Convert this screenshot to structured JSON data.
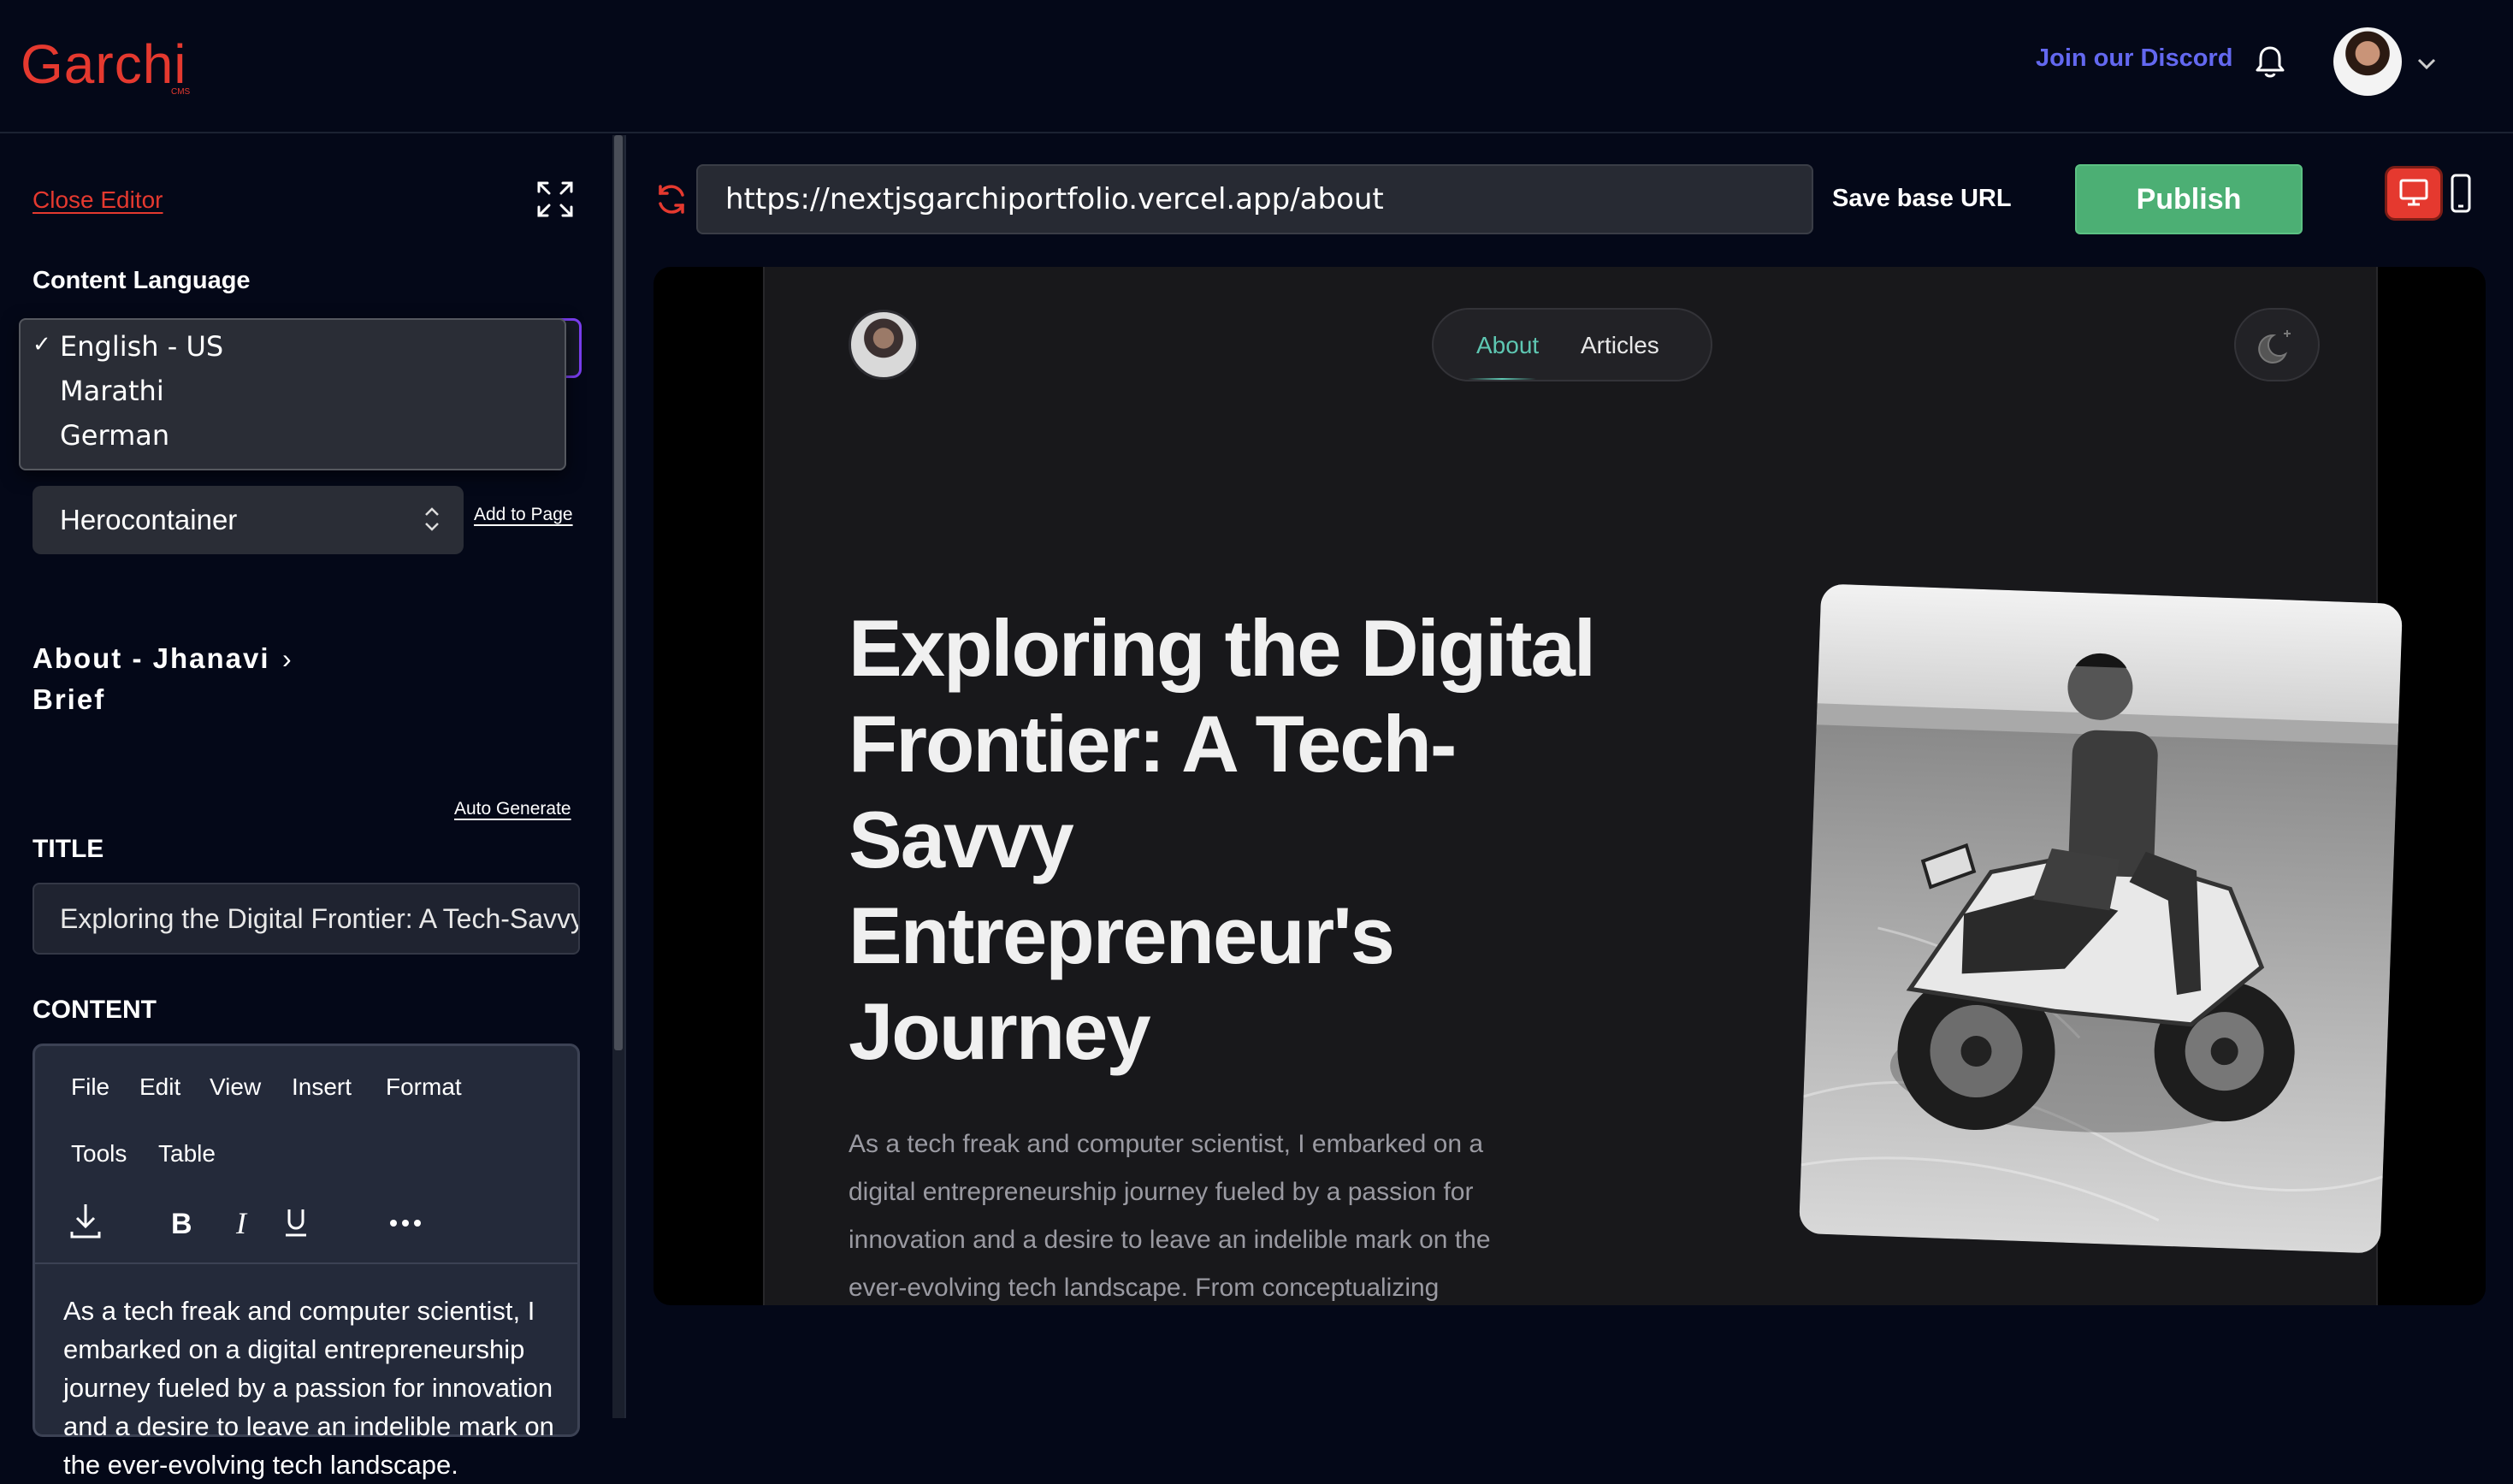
{
  "header": {
    "logo": "Garchi",
    "logo_sub": "CMS",
    "discord_link": "Join our Discord",
    "icons": [
      "bell-icon",
      "user-avatar",
      "chevron-down-icon"
    ]
  },
  "sidebar": {
    "close_editor": "Close Editor",
    "content_language_label": "Content Language",
    "language_options": [
      "English - US",
      "Marathi",
      "German"
    ],
    "selected_language": "English - US",
    "section_select_value": "Herocontainer",
    "add_to_page": "Add to Page",
    "page_title": "About - Jhanavi Brief",
    "auto_generate": "Auto Generate",
    "title_label": "TITLE",
    "title_value": "Exploring the Digital Frontier: A Tech-Savvy Entrepreneur's Journey",
    "content_label": "CONTENT",
    "editor_menu": [
      "File",
      "Edit",
      "View",
      "Insert",
      "Format",
      "Tools",
      "Table"
    ],
    "editor_text": "As a tech freak and computer scientist, I embarked on a digital entrepreneurship journey fueled by a passion for innovation and a desire to leave an indelible mark on the ever-evolving tech landscape."
  },
  "toolbar": {
    "url": "https://nextjsgarchiportfolio.vercel.app/about",
    "save_base_url": "Save base URL",
    "publish": "Publish",
    "accent_color": "#4caf74",
    "brand_color": "#e5392f"
  },
  "preview": {
    "nav": [
      "About",
      "Articles"
    ],
    "active_nav": "About",
    "heading": "Exploring the Digital Frontier: A Tech-Savvy Entrepreneur's Journey",
    "paragraph": "As a tech freak and computer scientist, I embarked on a digital entrepreneurship journey fueled by a passion for innovation and a desire to leave an indelible mark on the ever-evolving tech landscape. From conceptualizing"
  }
}
